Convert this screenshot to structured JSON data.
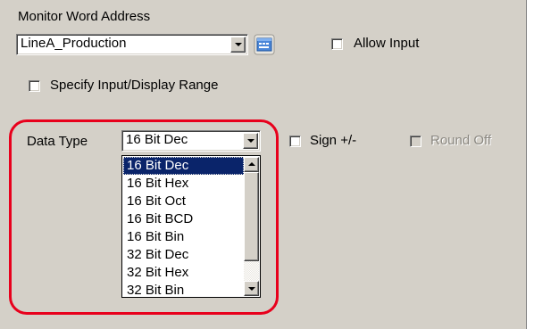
{
  "monitor_word_address": {
    "label": "Monitor Word Address",
    "value": "LineA_Production",
    "icon": "address-input-keyboard-icon"
  },
  "allow_input": {
    "label": "Allow Input",
    "checked": false
  },
  "specify_range": {
    "label": "Specify Input/Display Range",
    "checked": false
  },
  "data_type": {
    "label": "Data Type",
    "selected": "16 Bit Dec",
    "options": [
      "16 Bit Dec",
      "16 Bit Hex",
      "16 Bit Oct",
      "16 Bit BCD",
      "16 Bit Bin",
      "32 Bit Dec",
      "32 Bit Hex",
      "32 Bit Bin"
    ]
  },
  "sign": {
    "label": "Sign +/-",
    "checked": false
  },
  "round_off": {
    "label": "Round Off",
    "checked": false,
    "enabled": false
  },
  "colors": {
    "panel": "#d4d0c8",
    "highlight_border": "#e8001c",
    "selection": "#0a246a"
  }
}
